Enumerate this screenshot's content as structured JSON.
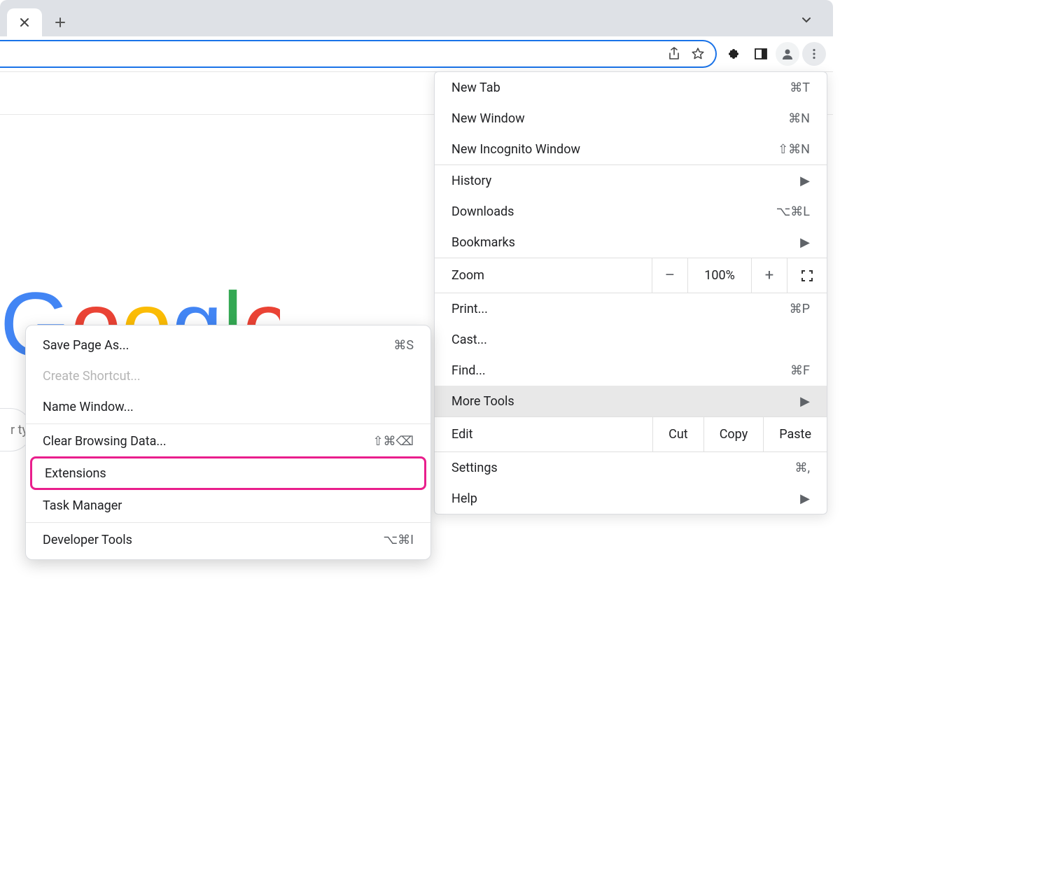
{
  "search_placeholder": "r ty",
  "menu": {
    "new_tab": "New Tab",
    "new_tab_sc": "⌘T",
    "new_window": "New Window",
    "new_window_sc": "⌘N",
    "incognito": "New Incognito Window",
    "incognito_sc": "⇧⌘N",
    "history": "History",
    "downloads": "Downloads",
    "downloads_sc": "⌥⌘L",
    "bookmarks": "Bookmarks",
    "zoom": "Zoom",
    "zoom_minus": "–",
    "zoom_pct": "100%",
    "zoom_plus": "+",
    "print": "Print...",
    "print_sc": "⌘P",
    "cast": "Cast...",
    "find": "Find...",
    "find_sc": "⌘F",
    "more_tools": "More Tools",
    "edit": "Edit",
    "cut": "Cut",
    "copy": "Copy",
    "paste": "Paste",
    "settings": "Settings",
    "settings_sc": "⌘,",
    "help": "Help"
  },
  "submenu": {
    "save_page": "Save Page As...",
    "save_page_sc": "⌘S",
    "create_shortcut": "Create Shortcut...",
    "name_window": "Name Window...",
    "clear_browsing": "Clear Browsing Data...",
    "clear_browsing_sc": "⇧⌘⌫",
    "extensions": "Extensions",
    "task_manager": "Task Manager",
    "developer_tools": "Developer Tools",
    "developer_tools_sc": "⌥⌘I"
  }
}
